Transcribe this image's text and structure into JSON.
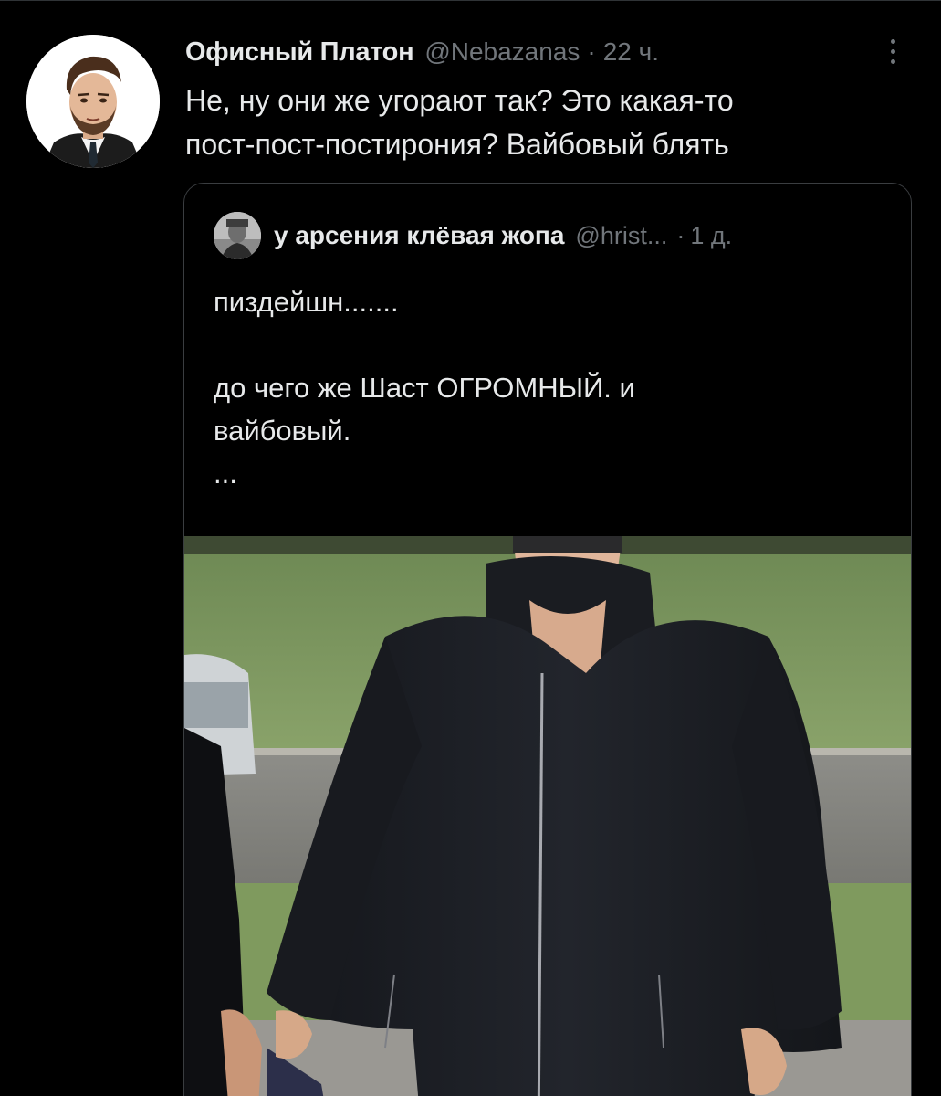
{
  "tweet": {
    "author_name": "Офисный Платон",
    "handle": "@Nebazanas",
    "separator": "·",
    "time": "22 ч.",
    "text_lines": [
      "Не, ну они же угорают так? Это какая-то",
      "пост-пост-постирония? Вайбовый блять"
    ],
    "more_icon": "more-vertical-icon"
  },
  "quote": {
    "author_name": "у арсения клёвая жопа",
    "handle": "@hrist...",
    "separator": "·",
    "time": "1 д.",
    "text_lines": [
      "пиздейшн.......",
      "",
      "до чего же Шаст ОГРОМНЫЙ. и",
      "вайбовый.",
      "..."
    ]
  },
  "colors": {
    "background": "#000000",
    "text_primary": "#e7e9ea",
    "text_secondary": "#71767b",
    "border": "#3a3d40"
  }
}
